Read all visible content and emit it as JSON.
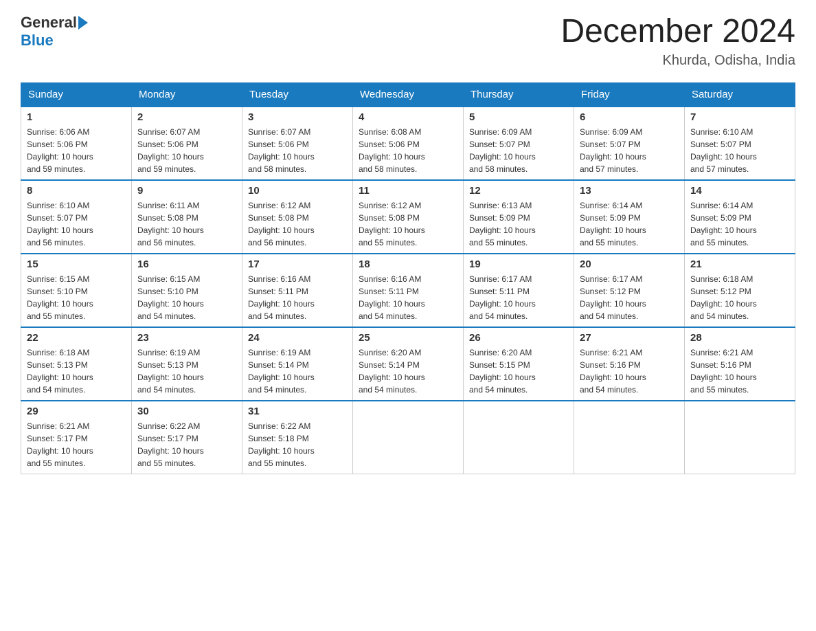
{
  "header": {
    "logo_general": "General",
    "logo_blue": "Blue",
    "month_title": "December 2024",
    "location": "Khurda, Odisha, India"
  },
  "days_of_week": [
    "Sunday",
    "Monday",
    "Tuesday",
    "Wednesday",
    "Thursday",
    "Friday",
    "Saturday"
  ],
  "weeks": [
    [
      {
        "day": "1",
        "sunrise": "6:06 AM",
        "sunset": "5:06 PM",
        "daylight": "10 hours and 59 minutes."
      },
      {
        "day": "2",
        "sunrise": "6:07 AM",
        "sunset": "5:06 PM",
        "daylight": "10 hours and 59 minutes."
      },
      {
        "day": "3",
        "sunrise": "6:07 AM",
        "sunset": "5:06 PM",
        "daylight": "10 hours and 58 minutes."
      },
      {
        "day": "4",
        "sunrise": "6:08 AM",
        "sunset": "5:06 PM",
        "daylight": "10 hours and 58 minutes."
      },
      {
        "day": "5",
        "sunrise": "6:09 AM",
        "sunset": "5:07 PM",
        "daylight": "10 hours and 58 minutes."
      },
      {
        "day": "6",
        "sunrise": "6:09 AM",
        "sunset": "5:07 PM",
        "daylight": "10 hours and 57 minutes."
      },
      {
        "day": "7",
        "sunrise": "6:10 AM",
        "sunset": "5:07 PM",
        "daylight": "10 hours and 57 minutes."
      }
    ],
    [
      {
        "day": "8",
        "sunrise": "6:10 AM",
        "sunset": "5:07 PM",
        "daylight": "10 hours and 56 minutes."
      },
      {
        "day": "9",
        "sunrise": "6:11 AM",
        "sunset": "5:08 PM",
        "daylight": "10 hours and 56 minutes."
      },
      {
        "day": "10",
        "sunrise": "6:12 AM",
        "sunset": "5:08 PM",
        "daylight": "10 hours and 56 minutes."
      },
      {
        "day": "11",
        "sunrise": "6:12 AM",
        "sunset": "5:08 PM",
        "daylight": "10 hours and 55 minutes."
      },
      {
        "day": "12",
        "sunrise": "6:13 AM",
        "sunset": "5:09 PM",
        "daylight": "10 hours and 55 minutes."
      },
      {
        "day": "13",
        "sunrise": "6:14 AM",
        "sunset": "5:09 PM",
        "daylight": "10 hours and 55 minutes."
      },
      {
        "day": "14",
        "sunrise": "6:14 AM",
        "sunset": "5:09 PM",
        "daylight": "10 hours and 55 minutes."
      }
    ],
    [
      {
        "day": "15",
        "sunrise": "6:15 AM",
        "sunset": "5:10 PM",
        "daylight": "10 hours and 55 minutes."
      },
      {
        "day": "16",
        "sunrise": "6:15 AM",
        "sunset": "5:10 PM",
        "daylight": "10 hours and 54 minutes."
      },
      {
        "day": "17",
        "sunrise": "6:16 AM",
        "sunset": "5:11 PM",
        "daylight": "10 hours and 54 minutes."
      },
      {
        "day": "18",
        "sunrise": "6:16 AM",
        "sunset": "5:11 PM",
        "daylight": "10 hours and 54 minutes."
      },
      {
        "day": "19",
        "sunrise": "6:17 AM",
        "sunset": "5:11 PM",
        "daylight": "10 hours and 54 minutes."
      },
      {
        "day": "20",
        "sunrise": "6:17 AM",
        "sunset": "5:12 PM",
        "daylight": "10 hours and 54 minutes."
      },
      {
        "day": "21",
        "sunrise": "6:18 AM",
        "sunset": "5:12 PM",
        "daylight": "10 hours and 54 minutes."
      }
    ],
    [
      {
        "day": "22",
        "sunrise": "6:18 AM",
        "sunset": "5:13 PM",
        "daylight": "10 hours and 54 minutes."
      },
      {
        "day": "23",
        "sunrise": "6:19 AM",
        "sunset": "5:13 PM",
        "daylight": "10 hours and 54 minutes."
      },
      {
        "day": "24",
        "sunrise": "6:19 AM",
        "sunset": "5:14 PM",
        "daylight": "10 hours and 54 minutes."
      },
      {
        "day": "25",
        "sunrise": "6:20 AM",
        "sunset": "5:14 PM",
        "daylight": "10 hours and 54 minutes."
      },
      {
        "day": "26",
        "sunrise": "6:20 AM",
        "sunset": "5:15 PM",
        "daylight": "10 hours and 54 minutes."
      },
      {
        "day": "27",
        "sunrise": "6:21 AM",
        "sunset": "5:16 PM",
        "daylight": "10 hours and 54 minutes."
      },
      {
        "day": "28",
        "sunrise": "6:21 AM",
        "sunset": "5:16 PM",
        "daylight": "10 hours and 55 minutes."
      }
    ],
    [
      {
        "day": "29",
        "sunrise": "6:21 AM",
        "sunset": "5:17 PM",
        "daylight": "10 hours and 55 minutes."
      },
      {
        "day": "30",
        "sunrise": "6:22 AM",
        "sunset": "5:17 PM",
        "daylight": "10 hours and 55 minutes."
      },
      {
        "day": "31",
        "sunrise": "6:22 AM",
        "sunset": "5:18 PM",
        "daylight": "10 hours and 55 minutes."
      },
      null,
      null,
      null,
      null
    ]
  ],
  "labels": {
    "sunrise": "Sunrise:",
    "sunset": "Sunset:",
    "daylight": "Daylight:"
  }
}
